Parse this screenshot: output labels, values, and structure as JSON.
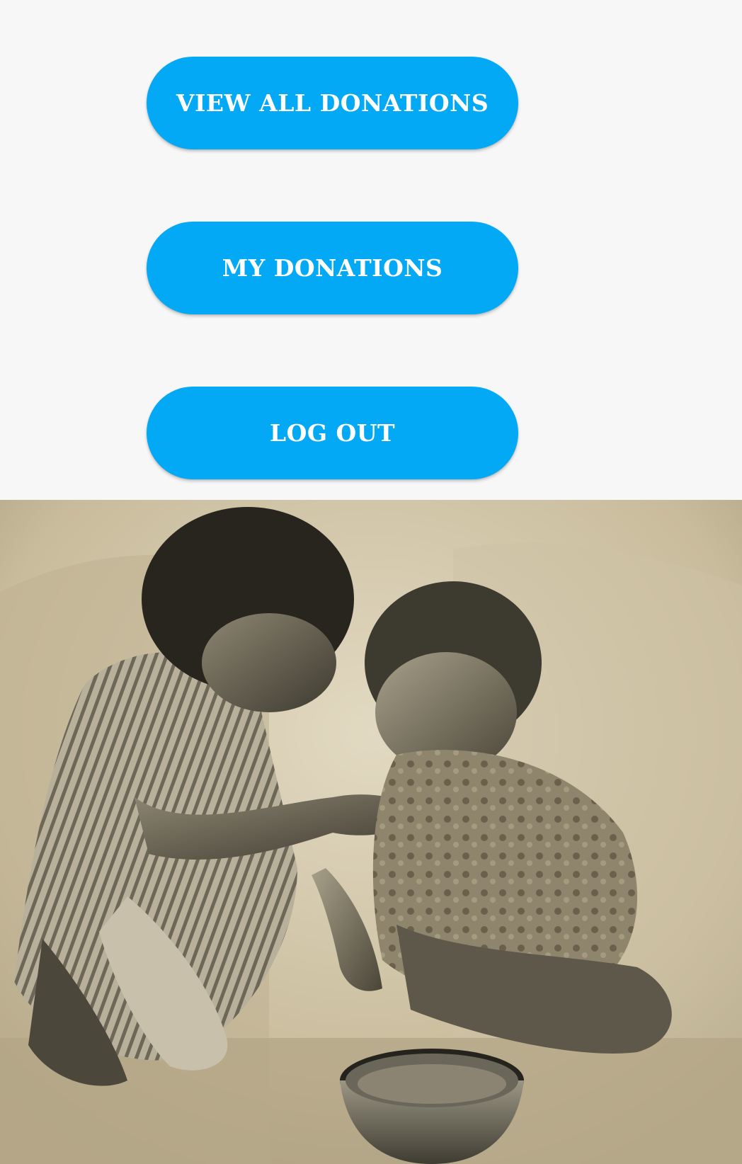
{
  "buttons": {
    "view_all_donations": "VIEW ALL DONATIONS",
    "my_donations": "MY DONATIONS",
    "log_out": "LOG OUT"
  },
  "theme": {
    "button_color": "#03a9f4",
    "button_text_color": "#ffffff",
    "background": "#f7f7f8"
  },
  "hero_image": {
    "subject": "sepia photo of a child feeding a smaller child beside a metal bowl"
  }
}
